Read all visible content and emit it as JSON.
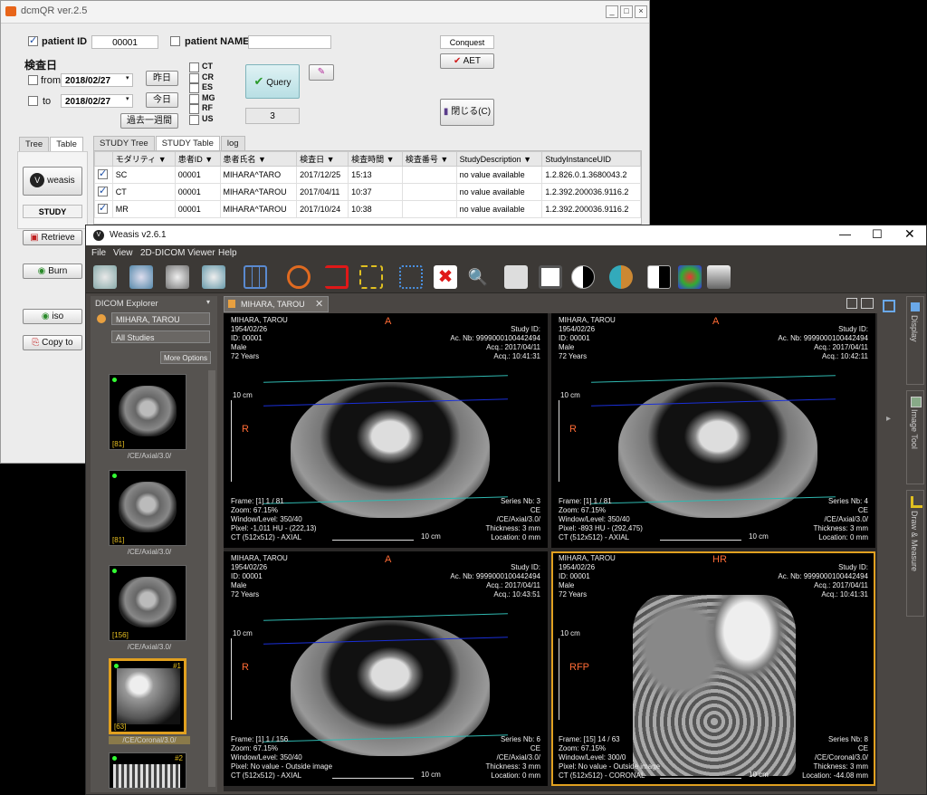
{
  "dcmqr": {
    "title": "dcmQR ver.2.5",
    "patient_id_label": "patient ID",
    "patient_id_value": "00001",
    "patient_name_label": "patient NAME",
    "patient_name_value": "",
    "exam_date_label": "検査日",
    "from_label": "from",
    "to_label": "to",
    "from_date": "2018/02/27",
    "to_date": "2018/02/27",
    "yesterday_button": "昨日",
    "today_button": "今日",
    "past_week_button": "過去一週間",
    "modalities": [
      "CT",
      "CR",
      "ES",
      "MG",
      "RF",
      "US"
    ],
    "query_button": "Query",
    "result_count": "3",
    "server_name": "Conquest",
    "aet_button": "AET",
    "close_button": "閉じる(C)",
    "left_tabs": [
      "Tree",
      "Table"
    ],
    "weasis_button": "weasis",
    "study_label": "STUDY",
    "retrieve_button": "Retrieve",
    "burn_button": "Burn",
    "iso_button": "iso",
    "copy_button": "Copy to",
    "main_tabs": [
      "STUDY Tree",
      "STUDY Table",
      "log"
    ],
    "columns": [
      "",
      "モダリティ ▼",
      "患者ID ▼",
      "患者氏名 ▼",
      "検査日 ▼",
      "検査時間 ▼",
      "検査番号 ▼",
      "StudyDescription ▼",
      "StudyInstanceUID"
    ],
    "rows": [
      {
        "mod": "SC",
        "pid": "00001",
        "name": "MIHARA^TARO",
        "date": "2017/12/25",
        "time": "15:13",
        "acc": "",
        "desc": "no value available",
        "uid": "1.2.826.0.1.3680043.2"
      },
      {
        "mod": "CT",
        "pid": "00001",
        "name": "MIHARA^TAROU",
        "date": "2017/04/11",
        "time": "10:37",
        "acc": "",
        "desc": "no value available",
        "uid": "1.2.392.200036.9116.2"
      },
      {
        "mod": "MR",
        "pid": "00001",
        "name": "MIHARA^TAROU",
        "date": "2017/10/24",
        "time": "10:38",
        "acc": "",
        "desc": "no value available",
        "uid": "1.2.392.200036.9116.2"
      }
    ]
  },
  "weasis": {
    "title": "Weasis v2.6.1",
    "menu": [
      "File",
      "View",
      "2D-DICOM Viewer",
      "Help"
    ],
    "explorer_title": "DICOM Explorer",
    "patient_select": "MIHARA, TAROU",
    "studies_select": "All Studies",
    "more_options": "More Options",
    "viewer_tab": "MIHARA, TAROU",
    "side_panels": [
      "Display",
      "Image Tool",
      "Draw & Measure"
    ],
    "thumbnails": [
      {
        "count": "[81]",
        "label": "/CE/Axial/3.0/"
      },
      {
        "count": "[81]",
        "label": "/CE/Axial/3.0/"
      },
      {
        "count": "[156]",
        "label": "/CE/Axial/3.0/"
      },
      {
        "count": "[63]",
        "label": "/CE/Coronal/3.0/",
        "badge": "#1"
      },
      {
        "count": "",
        "label": "",
        "badge": "#2"
      }
    ],
    "viewports": [
      {
        "name": "MIHARA, TAROU",
        "dob": "1954/02/26",
        "id": "ID: 00001",
        "sex": "Male",
        "age": "72 Years",
        "study_id": "Study ID:",
        "acc": "Ac. Nb: 9999000100442494",
        "acq_date": "Acq.: 2017/04/11",
        "acq_time": "Acq.: 10:41:31",
        "top": "A",
        "left": "R",
        "scale": "10 cm",
        "frame": "Frame: [1] 1 / 81",
        "zoom": "Zoom: 67.15%",
        "wl": "Window/Level: 350/40",
        "pixel": "Pixel: -1,011 HU - (222,13)",
        "ct": "CT (512x512) - AXIAL",
        "series": "Series Nb: 3",
        "ce": "CE",
        "series_desc": "/CE/Axial/3.0/",
        "thickness": "Thickness: 3 mm",
        "location": "Location: 0 mm",
        "bottom_scale": "10 cm"
      },
      {
        "name": "MIHARA, TAROU",
        "dob": "1954/02/26",
        "id": "ID: 00001",
        "sex": "Male",
        "age": "72 Years",
        "study_id": "Study ID:",
        "acc": "Ac. Nb: 9999000100442494",
        "acq_date": "Acq.: 2017/04/11",
        "acq_time": "Acq.: 10:42:11",
        "top": "A",
        "left": "R",
        "scale": "10 cm",
        "frame": "Frame: [1] 1 / 81",
        "zoom": "Zoom: 67.15%",
        "wl": "Window/Level: 350/40",
        "pixel": "Pixel: -893 HU - (292,475)",
        "ct": "CT (512x512) - AXIAL",
        "series": "Series Nb: 4",
        "ce": "CE",
        "series_desc": "/CE/Axial/3.0/",
        "thickness": "Thickness: 3 mm",
        "location": "Location: 0 mm",
        "bottom_scale": "10 cm"
      },
      {
        "name": "MIHARA, TAROU",
        "dob": "1954/02/26",
        "id": "ID: 00001",
        "sex": "Male",
        "age": "72 Years",
        "study_id": "Study ID:",
        "acc": "Ac. Nb: 9999000100442494",
        "acq_date": "Acq.: 2017/04/11",
        "acq_time": "Acq.: 10:43:51",
        "top": "A",
        "left": "R",
        "scale": "10 cm",
        "frame": "Frame: [1] 1 / 156",
        "zoom": "Zoom: 67.15%",
        "wl": "Window/Level: 350/40",
        "pixel": "Pixel: No value - Outside image",
        "ct": "CT (512x512) - AXIAL",
        "series": "Series Nb: 6",
        "ce": "CE",
        "series_desc": "/CE/Axial/3.0/",
        "thickness": "Thickness: 3 mm",
        "location": "Location: 0 mm",
        "bottom_scale": "10 cm"
      },
      {
        "name": "MIHARA, TAROU",
        "dob": "1954/02/26",
        "id": "ID: 00001",
        "sex": "Male",
        "age": "72 Years",
        "study_id": "Study ID:",
        "acc": "Ac. Nb: 9999000100442494",
        "acq_date": "Acq.: 2017/04/11",
        "acq_time": "Acq.: 10:41:31",
        "top": "HR",
        "left": "RFP",
        "scale": "10 cm",
        "frame": "Frame: [15] 14 / 63",
        "zoom": "Zoom: 67.15%",
        "wl": "Window/Level: 300/0",
        "pixel": "Pixel: No value - Outside image",
        "ct": "CT (512x512) - CORONAL",
        "series": "Series Nb: 8",
        "ce": "CE",
        "series_desc": "/CE/Coronal/3.0/",
        "thickness": "Thickness: 3 mm",
        "location": "Location: -44.08 mm",
        "bottom_scale": "10 cm"
      }
    ]
  },
  "colors": {
    "accent_orange": "#ff6b35",
    "selected_border": "#e0a020",
    "scout_line_cyan": "#2fb8b0",
    "scout_line_blue": "#1a2fd8"
  }
}
